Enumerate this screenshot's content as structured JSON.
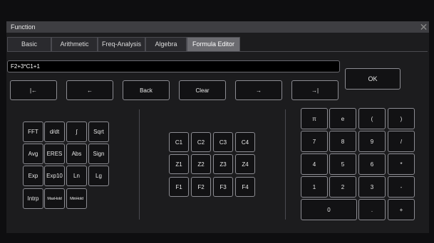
{
  "window": {
    "title": "Function",
    "close_icon": "close-icon"
  },
  "tabs": [
    "Basic",
    "Arithmetic",
    "Freq-Analysis",
    "Algebra",
    "Formula Editor"
  ],
  "active_tab": "Formula Editor",
  "formula": {
    "value": "F2+3*C1+1"
  },
  "ok_label": "OK",
  "nav_buttons": [
    "|←",
    "←",
    "Back",
    "Clear",
    "→",
    "→|"
  ],
  "functions": [
    [
      "FFT",
      "d/dt",
      "∫",
      "Sqrt"
    ],
    [
      "Avg",
      "ERES",
      "Abs",
      "Sign"
    ],
    [
      "Exp",
      "Exp10",
      "Ln",
      "Lg"
    ],
    [
      "Intrp",
      "MaxHold",
      "MinHold"
    ]
  ],
  "sources": [
    [
      "C1",
      "C2",
      "C3",
      "C4"
    ],
    [
      "Z1",
      "Z2",
      "Z3",
      "Z4"
    ],
    [
      "F1",
      "F2",
      "F3",
      "F4"
    ]
  ],
  "keypad": [
    [
      "π",
      "e",
      "(",
      ")"
    ],
    [
      "7",
      "8",
      "9",
      "/"
    ],
    [
      "4",
      "5",
      "6",
      "*"
    ],
    [
      "1",
      "2",
      "3",
      "-"
    ],
    [
      "0",
      ".",
      "+"
    ]
  ]
}
